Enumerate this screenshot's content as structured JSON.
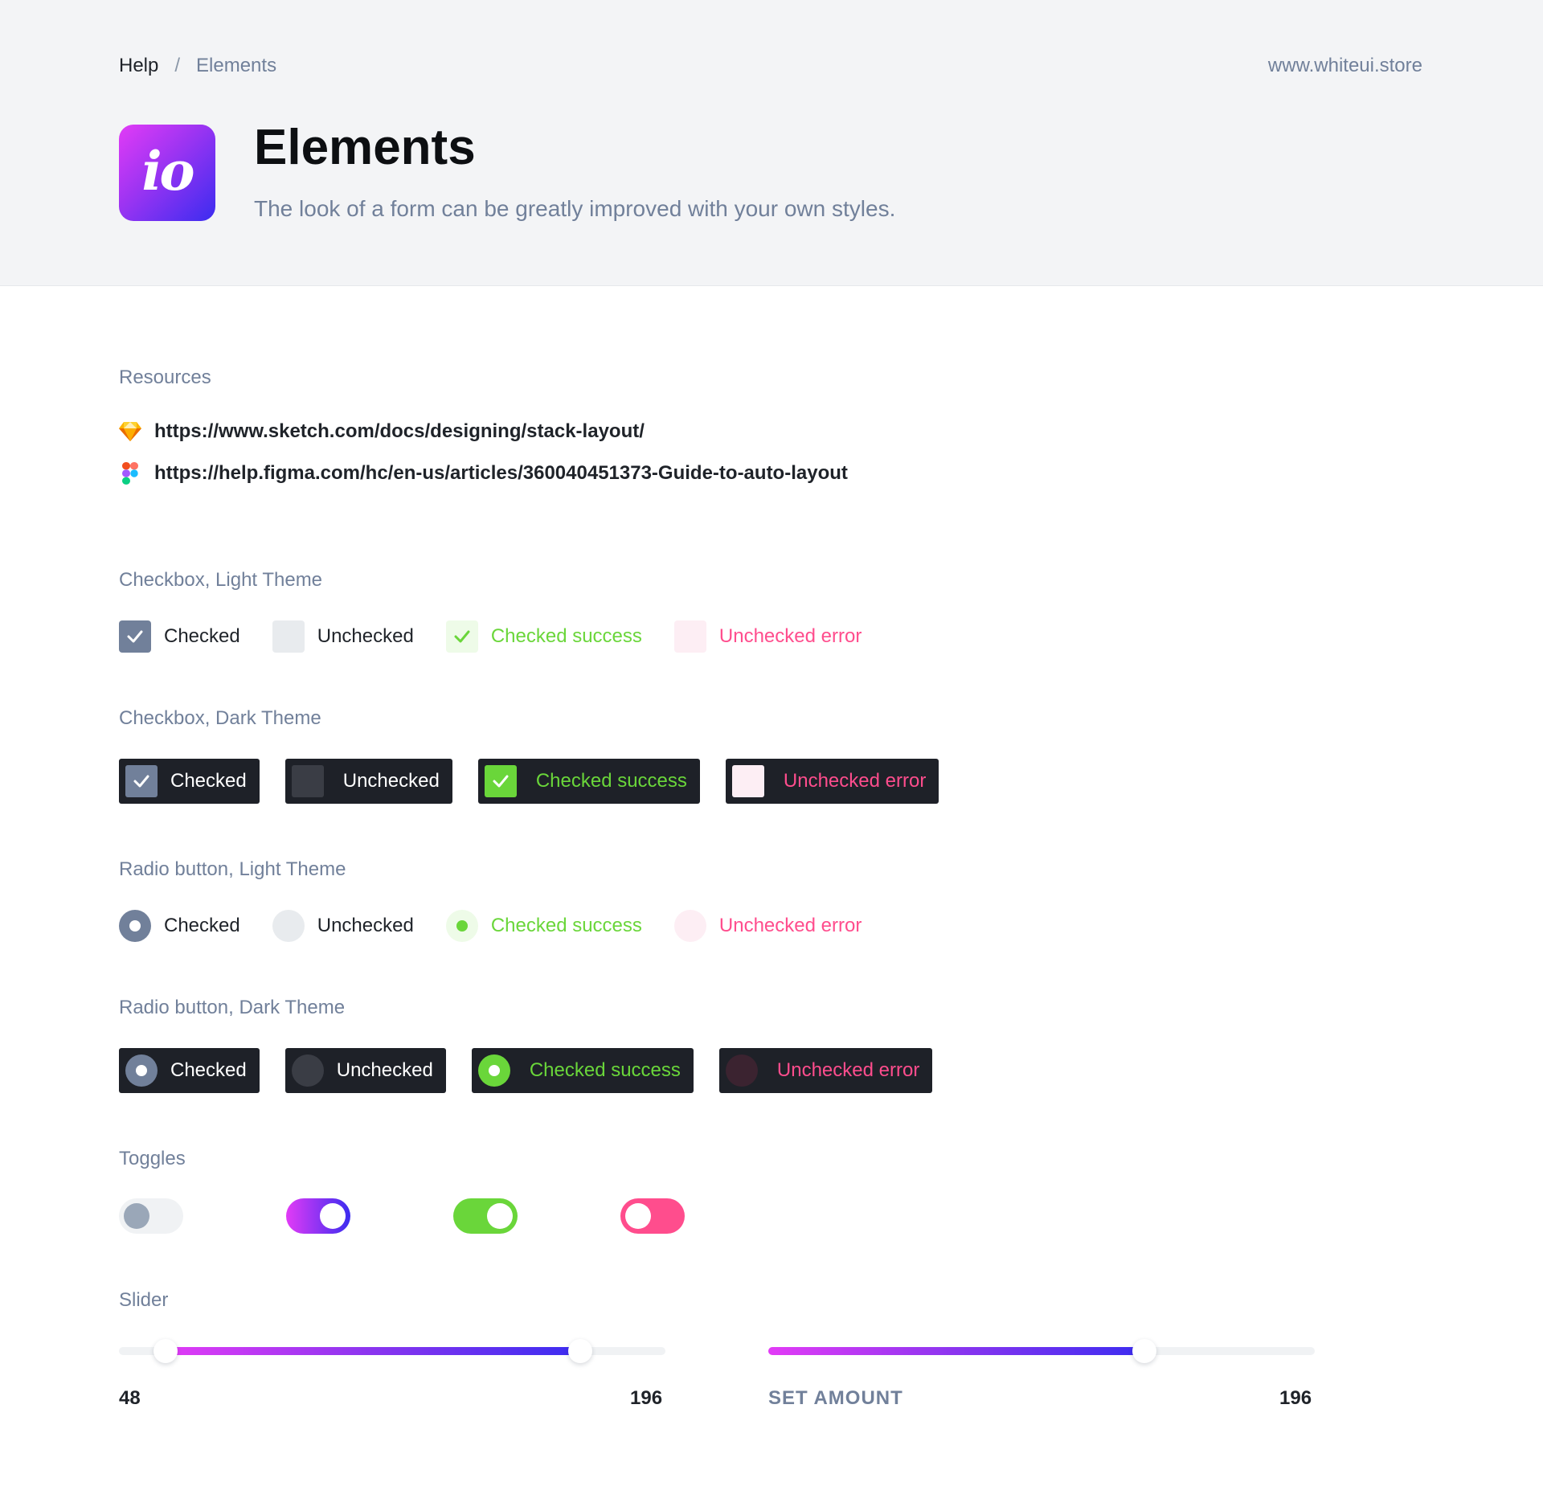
{
  "breadcrumb": {
    "home": "Help",
    "separator": "/",
    "current": "Elements"
  },
  "store_link": "www.whiteui.store",
  "logo_text": "io",
  "title": "Elements",
  "subtitle": "The look of a form can be greatly improved with your own styles.",
  "resources": {
    "heading": "Resources",
    "items": [
      {
        "icon": "sketch-icon",
        "url": "https://www.sketch.com/docs/designing/stack-layout/"
      },
      {
        "icon": "figma-icon",
        "url": "https://help.figma.com/hc/en-us/articles/360040451373-Guide-to-auto-layout"
      }
    ]
  },
  "checkbox_light": {
    "heading": "Checkbox, Light Theme",
    "items": [
      "Checked",
      "Unchecked",
      "Checked success",
      "Unchecked error"
    ]
  },
  "checkbox_dark": {
    "heading": "Checkbox, Dark Theme",
    "items": [
      "Checked",
      "Unchecked",
      "Checked success",
      "Unchecked error"
    ]
  },
  "radio_light": {
    "heading": "Radio button, Light Theme",
    "items": [
      "Checked",
      "Unchecked",
      "Checked success",
      "Unchecked error"
    ]
  },
  "radio_dark": {
    "heading": "Radio button, Dark Theme",
    "items": [
      "Checked",
      "Unchecked",
      "Checked success",
      "Unchecked error"
    ]
  },
  "toggles": {
    "heading": "Toggles",
    "states": [
      {
        "on": false,
        "color": "#f0f2f4"
      },
      {
        "on": true,
        "color": "#8a35ef"
      },
      {
        "on": true,
        "color": "#6ad63a"
      },
      {
        "on": false,
        "color": "#ff4d8d"
      }
    ]
  },
  "slider": {
    "heading": "Slider",
    "range": {
      "min_label": "48",
      "max_label": "196",
      "low": 48,
      "high": 196
    },
    "amount": {
      "caption": "SET AMOUNT",
      "value_label": "196",
      "value": 196
    }
  },
  "colors": {
    "accent_gray": "#71809a",
    "success": "#6ad63a",
    "error": "#ff4d8d",
    "dark_bg": "#1e2128"
  }
}
